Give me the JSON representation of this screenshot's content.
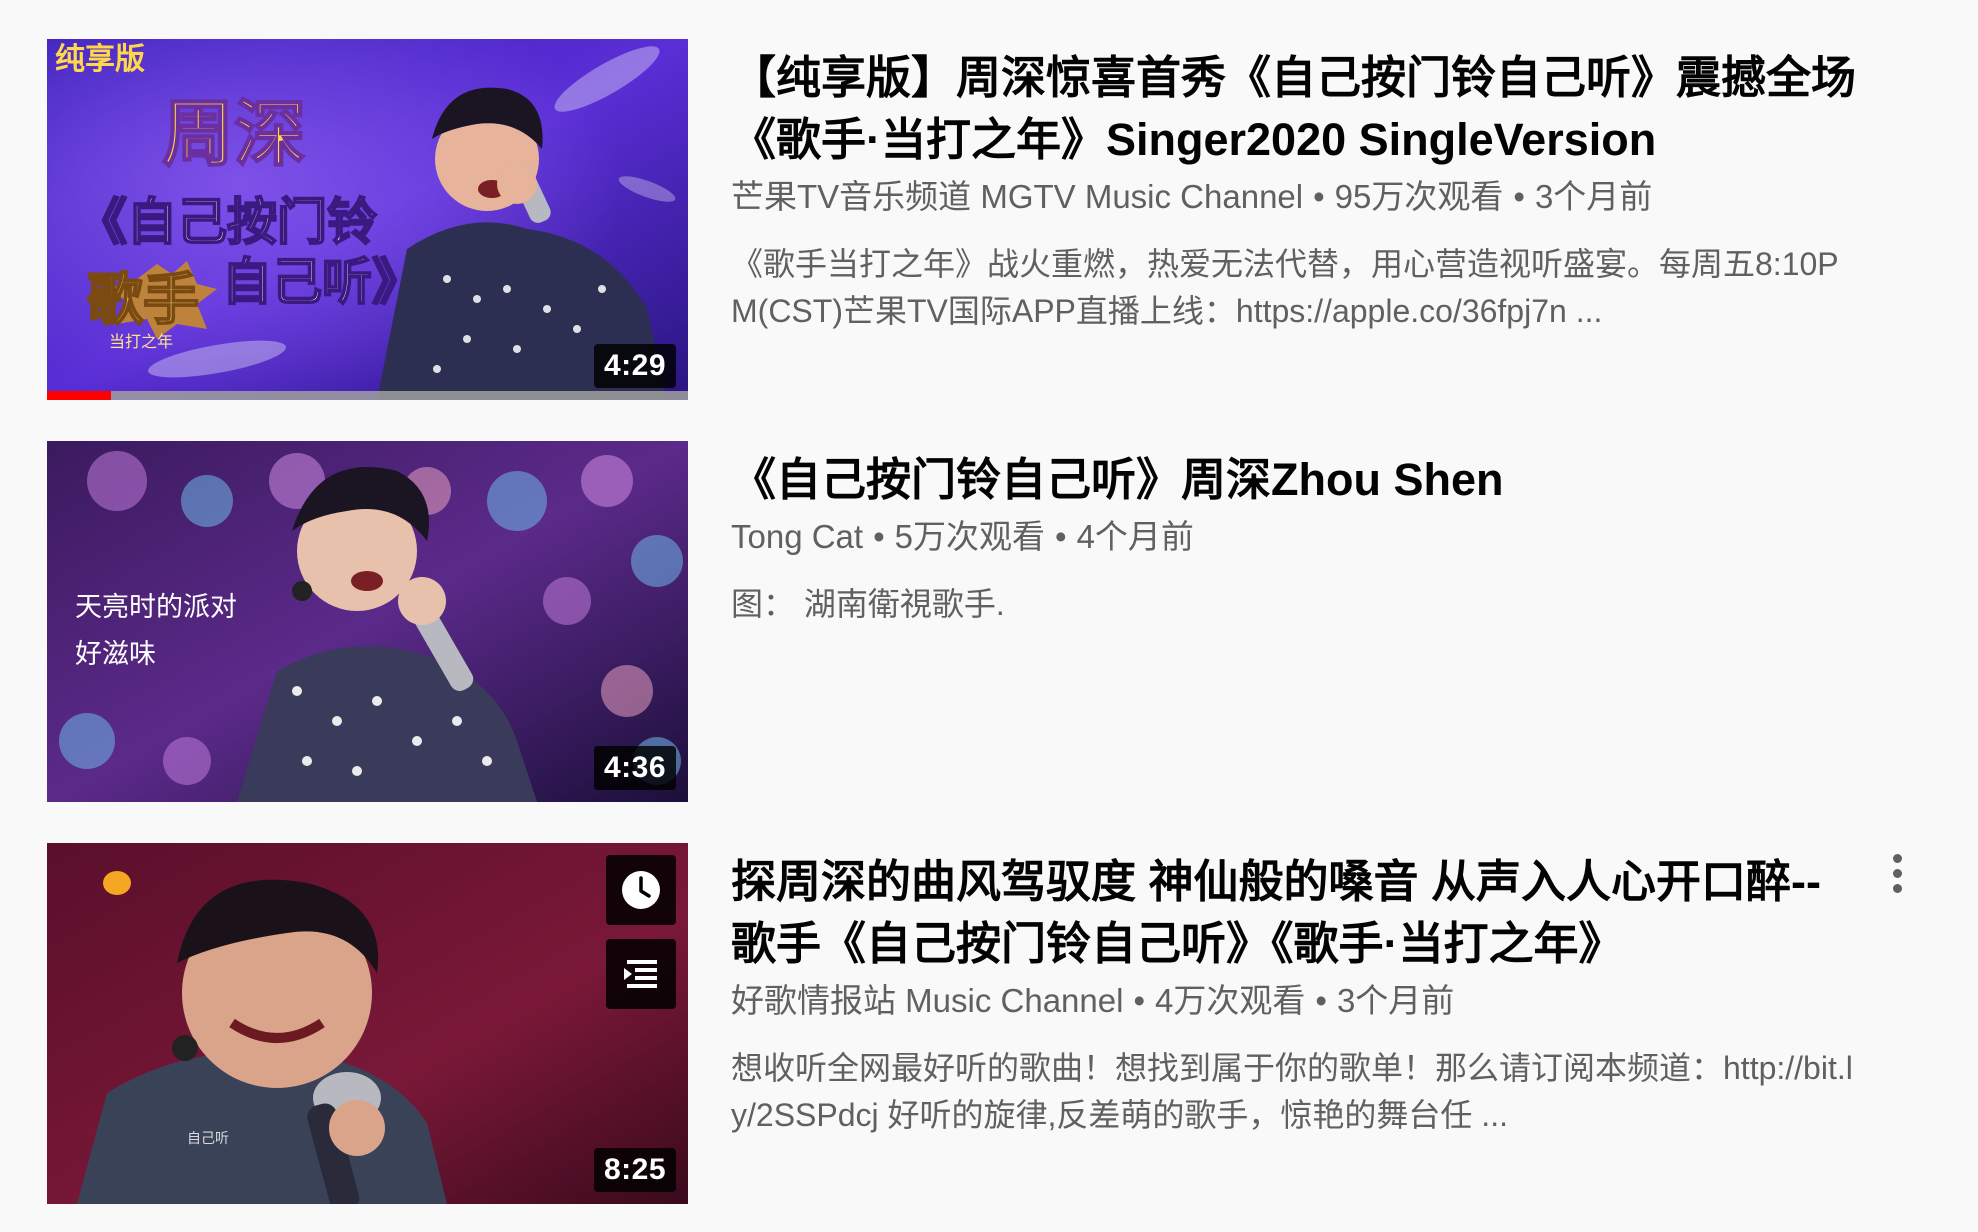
{
  "colors": {
    "page_background": "#f9f9f9",
    "title_text": "#030303",
    "meta_text": "#606060",
    "progress_red": "#ff0000"
  },
  "videos": [
    {
      "title": "【纯享版】周深惊喜首秀《自己按门铃自己听》震撼全场《歌手·当打之年》Singer2020 SingleVersion",
      "channel": "芒果TV音乐频道 MGTV Music Channel",
      "views": "95万次观看",
      "age": "3个月前",
      "description": "《歌手当打之年》战火重燃，热爱无法代替，用心营造视听盛宴。每周五8:10PM(CST)芒果TV国际APP直播上线：https://apple.co/36fpj7n ...",
      "duration": "4:29",
      "watched_progress": 0.1,
      "thumb_text": {
        "badge": "纯享版",
        "name": "周深",
        "song_line1": "《自己按门铃",
        "song_line2": "自己听》",
        "logo": "歌手",
        "logo_sub": "当打之年"
      }
    },
    {
      "title": "《自己按门铃自己听》周深Zhou Shen",
      "channel": "Tong Cat",
      "views": "5万次观看",
      "age": "4个月前",
      "description": "图：  湖南衛視歌手.",
      "duration": "4:36",
      "thumb_text": {
        "line1": "天亮时的派对",
        "line2": "好滋味"
      }
    },
    {
      "title": "探周深的曲风驾驭度 神仙般的嗓音 从声入人心开口醉--歌手《自己按门铃自己听》《歌手·当打之年》",
      "channel": "好歌情报站 Music Channel",
      "views": "4万次观看",
      "age": "3个月前",
      "description": "想收听全网最好听的歌曲！想找到属于你的歌单！那么请订阅本频道：http://bit.ly/2SSPdcj 好听的旋律,反差萌的歌手，惊艳的舞台任 ...",
      "duration": "8:25",
      "hover_icons": [
        "watch-later-clock-icon",
        "add-to-queue-icon"
      ],
      "thumb_text": {
        "subtitle": "自己听"
      }
    }
  ]
}
